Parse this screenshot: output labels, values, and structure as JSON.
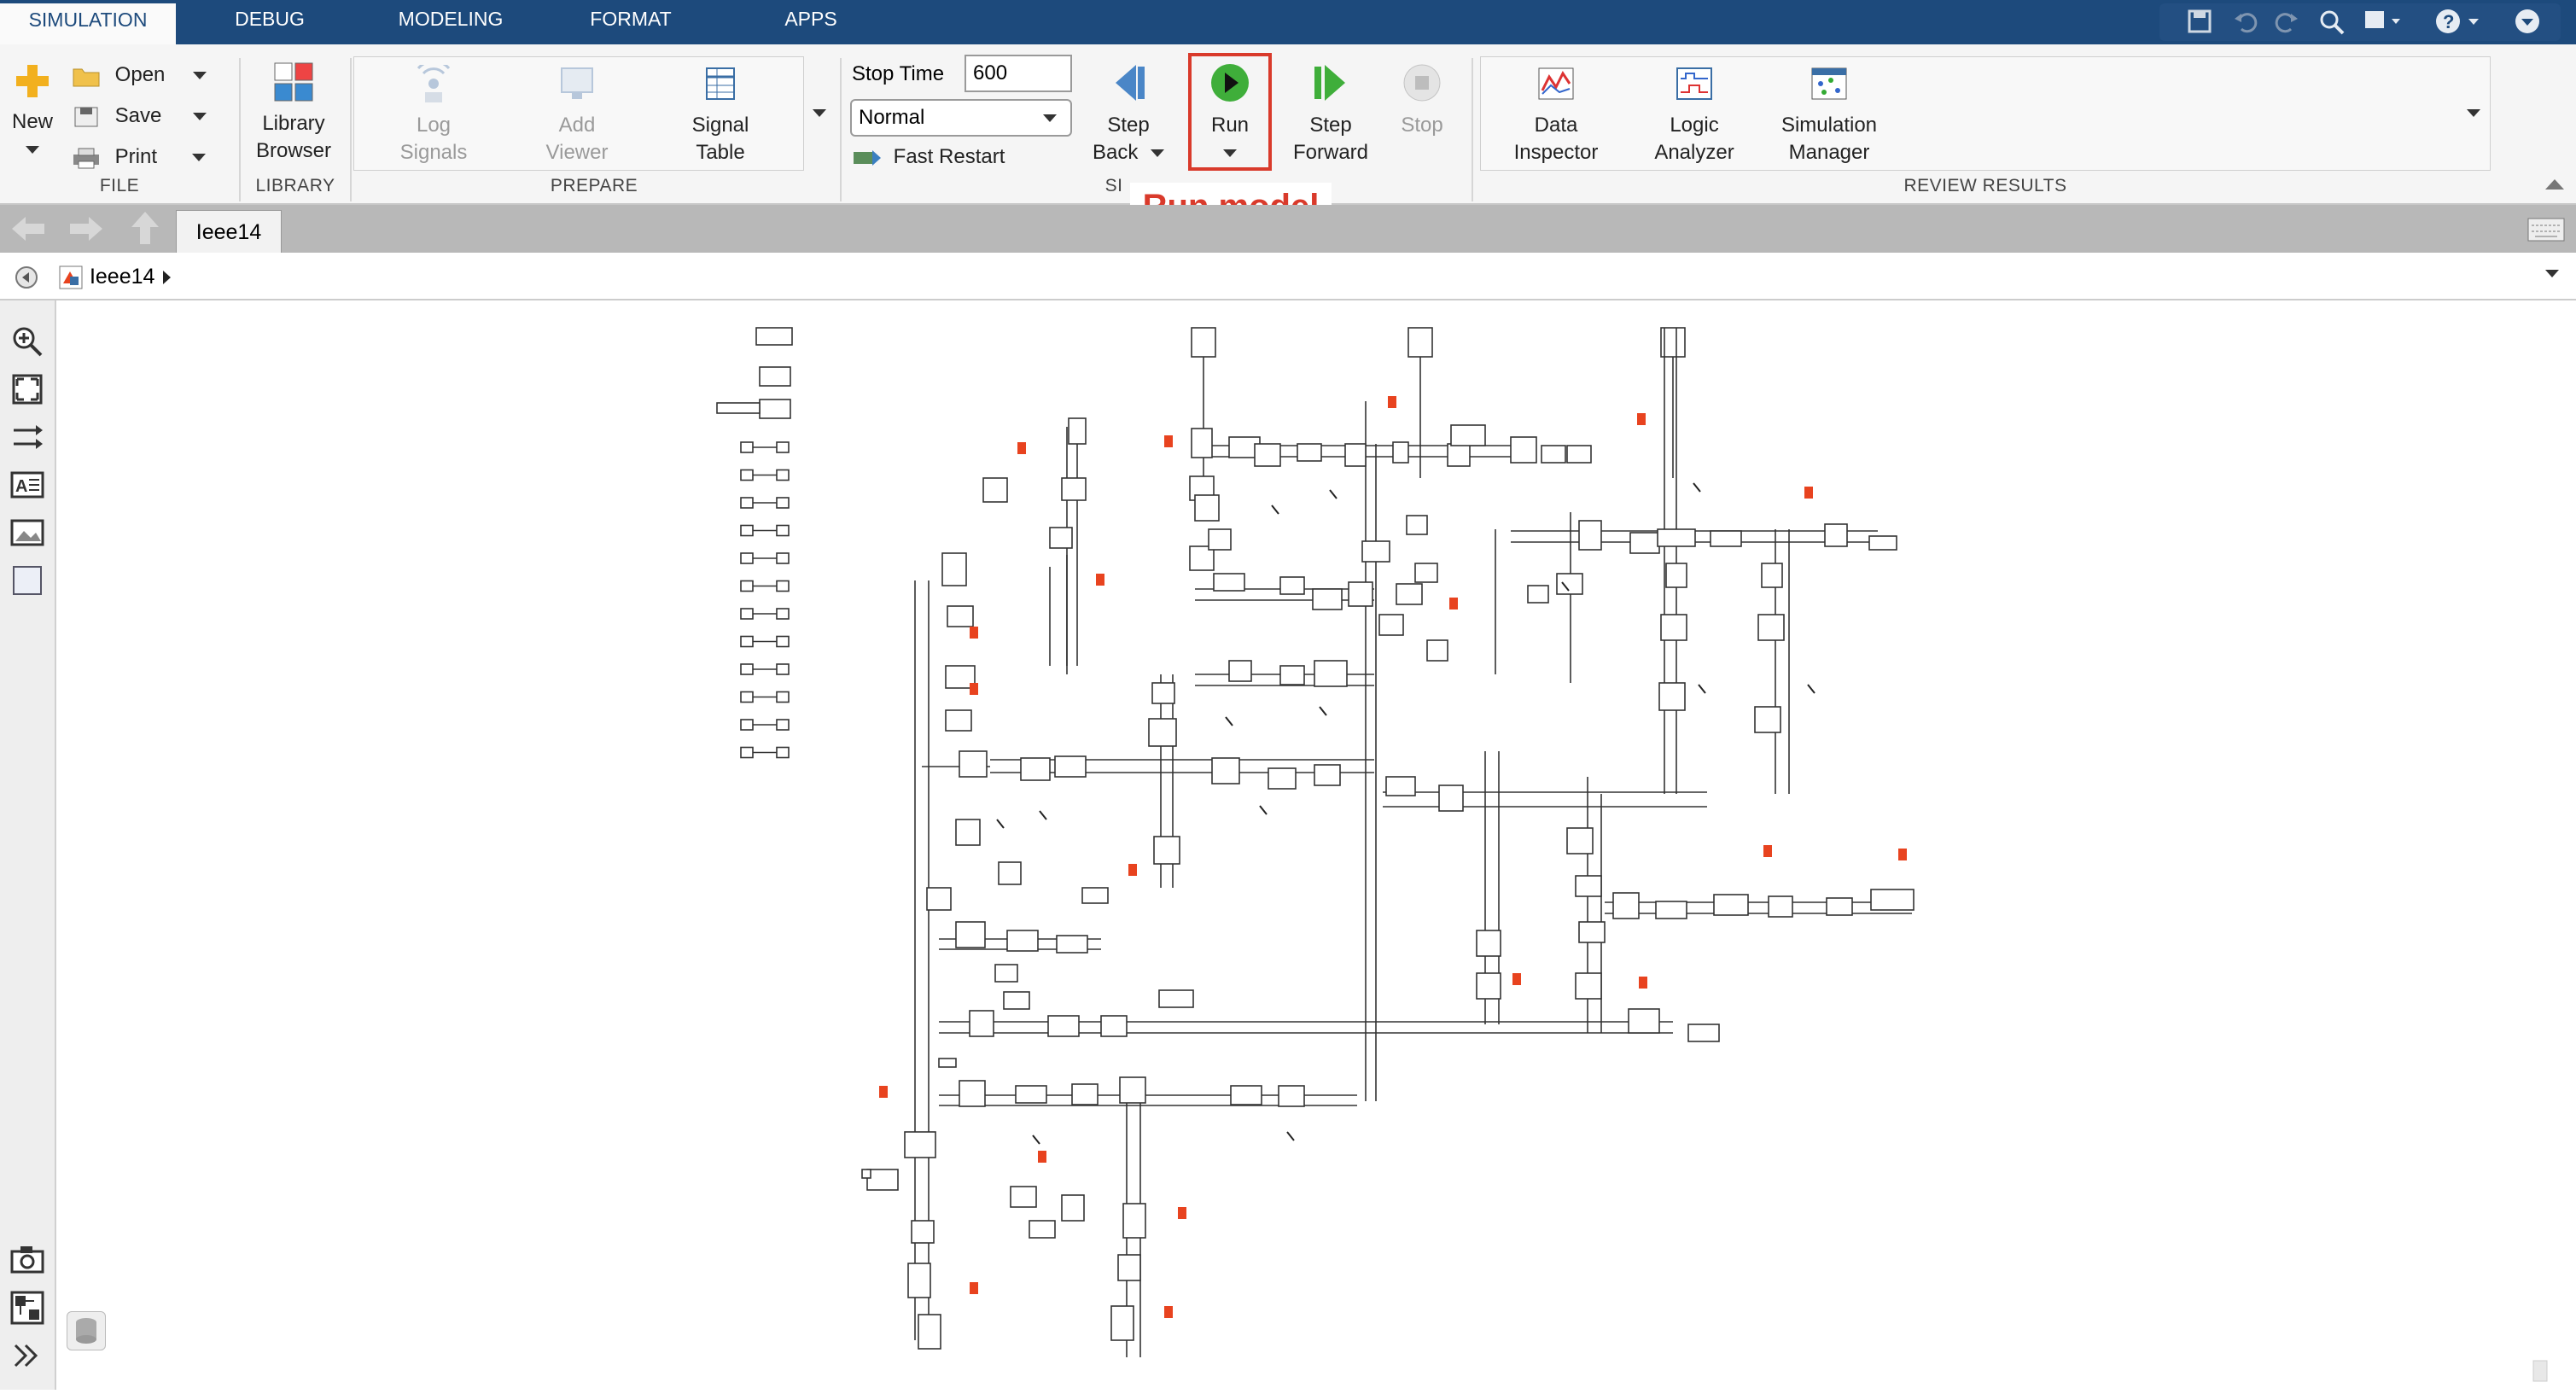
{
  "tabs": [
    "SIMULATION",
    "DEBUG",
    "MODELING",
    "FORMAT",
    "APPS"
  ],
  "ribbon": {
    "file": {
      "new": "New",
      "open": "Open",
      "save": "Save",
      "print": "Print",
      "label": "FILE"
    },
    "library": {
      "browser_line1": "Library",
      "browser_line2": "Browser",
      "label": "LIBRARY"
    },
    "prepare": {
      "log_line1": "Log",
      "log_line2": "Signals",
      "add_line1": "Add",
      "add_line2": "Viewer",
      "table_line1": "Signal",
      "table_line2": "Table",
      "label": "PREPARE"
    },
    "simulate": {
      "stop_time_label": "Stop Time",
      "stop_time_value": "600",
      "mode_value": "Normal",
      "fast_restart": "Fast Restart",
      "step_back_line1": "Step",
      "step_back_line2": "Back",
      "run": "Run",
      "step_forward_line1": "Step",
      "step_forward_line2": "Forward",
      "stop": "Stop",
      "label_fragment": "SI"
    },
    "review": {
      "data_line1": "Data",
      "data_line2": "Inspector",
      "logic_line1": "Logic",
      "logic_line2": "Analyzer",
      "simmgr_line1": "Simulation",
      "simmgr_line2": "Manager",
      "label": "REVIEW RESULTS"
    }
  },
  "callout": "Run model",
  "document_tab": "Ieee14",
  "breadcrumb": "Ieee14",
  "colors": {
    "accent": "#1d4a7c",
    "callout": "#d93a2b",
    "run_green": "#3fae3a",
    "marker_red": "#e8431f"
  },
  "icons": {
    "qa": [
      "save-icon",
      "undo-icon",
      "redo-icon",
      "search-icon",
      "help-icon"
    ],
    "tools": [
      "zoom-icon",
      "fit-view-icon",
      "arrange-icon",
      "annotation-icon",
      "image-icon",
      "area-icon",
      "screenshot-icon",
      "model-browser-icon",
      "expand-icon"
    ]
  }
}
